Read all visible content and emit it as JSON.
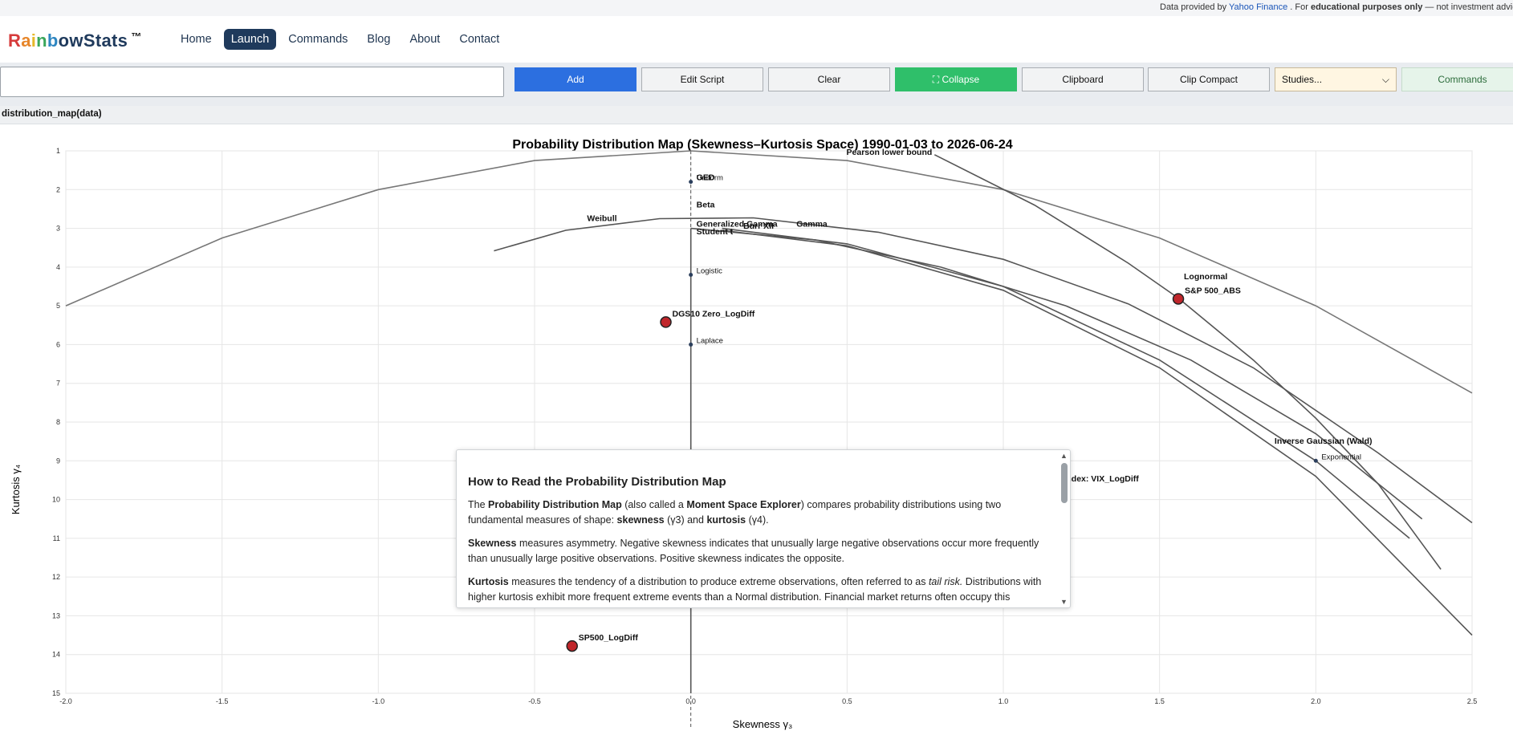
{
  "topinfo": {
    "prefix": "Data provided by",
    "source": "Yahoo Finance",
    "mid": ". For",
    "emph": "educational purposes only",
    "tail": "— not investment advice"
  },
  "brand": {
    "letters": [
      "R",
      "a",
      "i",
      "n",
      "b",
      "o",
      "w",
      "S",
      "t",
      "a",
      "t",
      "s"
    ],
    "colors": [
      "#d63b3b",
      "#e7862a",
      "#e5b82a",
      "#3aa65a",
      "#2e86c1",
      "#1f3a5c",
      "#1f3a5c",
      "#1f3a5c",
      "#1f3a5c",
      "#1f3a5c",
      "#1f3a5c",
      "#1f3a5c"
    ],
    "tm": "™"
  },
  "nav": {
    "home": "Home",
    "launch": "Launch",
    "commands": "Commands",
    "blog": "Blog",
    "about": "About",
    "contact": "Contact"
  },
  "toolbar": {
    "input_value": "",
    "add": "Add",
    "edit_script": "Edit Script",
    "clear": "Clear",
    "collapse": "⛶ Collapse",
    "clipboard": "Clipboard",
    "clip_compact": "Clip Compact",
    "studies": "Studies...",
    "commands": "Commands"
  },
  "expr": "distribution_map(data)",
  "help": {
    "title": "How to Read the Probability Distribution Map",
    "p1_a": "The",
    "p1_b": "Probability Distribution Map",
    "p1_c": "(also called a",
    "p1_d": "Moment Space Explorer",
    "p1_e": ") compares probability distributions using two fundamental measures of shape:",
    "p1_f": "skewness",
    "p1_g": "(γ3) and",
    "p1_h": "kurtosis",
    "p1_i": "(γ4).",
    "p2_a": "Skewness",
    "p2_b": "measures asymmetry. Negative skewness indicates that unusually large negative observations occur more frequently than unusually large positive observations. Positive skewness indicates the opposite.",
    "p3_a": "Kurtosis",
    "p3_b": "measures the tendency of a distribution to produce extreme observations, often referred to as",
    "p3_c": "tail risk.",
    "p3_d": "Distributions with higher kurtosis exhibit more frequent extreme events than a Normal distribution. Financial market returns often occupy this"
  },
  "chart_data": {
    "type": "scatter",
    "title": "Probability Distribution Map (Skewness–Kurtosis Space) 1990-01-03 to 2026-06-24",
    "xlabel": "Skewness γ₃",
    "ylabel": "Kurtosis γ₄",
    "xlim": [
      -2.0,
      2.5
    ],
    "ylim": [
      1,
      15
    ],
    "y_inverted": true,
    "xticks": [
      "-2.0",
      "-1.5",
      "-1.0",
      "-0.5",
      "0.0",
      "0.5",
      "1.0",
      "1.5",
      "2.0",
      "2.5"
    ],
    "xtick_values": [
      -2.0,
      -1.5,
      -1.0,
      -0.5,
      0.0,
      0.5,
      1.0,
      1.5,
      2.0,
      2.5
    ],
    "yticks": [
      "1",
      "2",
      "3",
      "4",
      "5",
      "6",
      "7",
      "8",
      "9",
      "10",
      "11",
      "12",
      "13",
      "14",
      "15"
    ],
    "ytick_values": [
      1,
      2,
      3,
      4,
      5,
      6,
      7,
      8,
      9,
      10,
      11,
      12,
      13,
      14,
      15
    ],
    "grid": true,
    "curves": [
      {
        "name": "Pearson lower bound",
        "color": "#777777",
        "points": [
          [
            -2.0,
            5.0
          ],
          [
            -1.5,
            3.25
          ],
          [
            -1.0,
            2.0
          ],
          [
            -0.5,
            1.25
          ],
          [
            0.0,
            1.0
          ],
          [
            0.5,
            1.25
          ],
          [
            1.0,
            2.0
          ],
          [
            1.5,
            3.25
          ],
          [
            2.0,
            5.0
          ],
          [
            2.5,
            7.25
          ]
        ]
      },
      {
        "name": "Lognormal",
        "color": "#555555",
        "points": [
          [
            0.78,
            1.1
          ],
          [
            1.1,
            2.4
          ],
          [
            1.4,
            3.9
          ],
          [
            1.56,
            4.8
          ],
          [
            1.8,
            6.4
          ],
          [
            2.0,
            7.9
          ],
          [
            2.2,
            9.6
          ],
          [
            2.4,
            11.8
          ]
        ]
      },
      {
        "name": "Weibull",
        "color": "#555555",
        "points": [
          [
            -0.63,
            3.58
          ],
          [
            -0.4,
            3.05
          ],
          [
            -0.1,
            2.75
          ],
          [
            0.2,
            2.73
          ],
          [
            0.6,
            3.1
          ],
          [
            1.0,
            3.8
          ],
          [
            1.4,
            4.95
          ],
          [
            1.8,
            6.6
          ],
          [
            2.2,
            8.8
          ],
          [
            2.5,
            10.6
          ]
        ]
      },
      {
        "name": "Generalized Gamma",
        "color": "#555555",
        "points": [
          [
            0.0,
            3.0
          ],
          [
            0.4,
            3.3
          ],
          [
            0.8,
            4.0
          ],
          [
            1.2,
            5.0
          ],
          [
            1.6,
            6.4
          ],
          [
            2.0,
            8.3
          ],
          [
            2.34,
            10.5
          ]
        ]
      },
      {
        "name": "Gamma",
        "color": "#555555",
        "points": [
          [
            0.1,
            3.0
          ],
          [
            0.5,
            3.4
          ],
          [
            1.0,
            4.5
          ],
          [
            1.5,
            6.4
          ],
          [
            2.0,
            9.0
          ],
          [
            2.3,
            11.0
          ]
        ]
      },
      {
        "name": "Burr XII",
        "color": "#555555",
        "points": [
          [
            0.1,
            3.05
          ],
          [
            0.5,
            3.45
          ],
          [
            1.0,
            4.6
          ],
          [
            1.5,
            6.6
          ],
          [
            2.0,
            9.4
          ],
          [
            2.5,
            13.5
          ]
        ]
      },
      {
        "name": "Student t",
        "color": "#555555",
        "points": [
          [
            0.0,
            3.0
          ],
          [
            0.0,
            15.0
          ]
        ]
      }
    ],
    "reference_points": [
      {
        "label": "Uniform",
        "x": 0.0,
        "y": 1.8
      },
      {
        "label": "GED",
        "x": 0.0,
        "y": 1.8,
        "bold": true
      },
      {
        "label": "Beta",
        "x": 0.0,
        "y": 2.5,
        "bold": true
      },
      {
        "label": "Generalized Gamma",
        "x": 0.0,
        "y": 3.0,
        "bold": true
      },
      {
        "label": "Burr XII",
        "x": 0.15,
        "y": 3.05,
        "bold": true
      },
      {
        "label": "Gamma",
        "x": 0.32,
        "y": 3.0,
        "bold": true
      },
      {
        "label": "Student t",
        "x": 0.0,
        "y": 3.2,
        "bold": true
      },
      {
        "label": "Weibull",
        "x": -0.35,
        "y": 2.85,
        "bold": true
      },
      {
        "label": "Logistic",
        "x": 0.0,
        "y": 4.2
      },
      {
        "label": "Laplace",
        "x": 0.0,
        "y": 6.0
      },
      {
        "label": "Exponential",
        "x": 2.0,
        "y": 9.0
      },
      {
        "label": "Inverse Gaussian (Wald)",
        "x": 1.85,
        "y": 8.6,
        "bold": true
      },
      {
        "label": "Lognormal",
        "x": 1.56,
        "y": 4.35,
        "bold": true
      },
      {
        "label": "Pearson lower bound",
        "x": 0.48,
        "y": 1.15,
        "bold": true
      }
    ],
    "series": [
      {
        "label": "S&P 500_ABS",
        "x": 1.56,
        "y": 4.82
      },
      {
        "label": "DGS10 Zero_LogDiff",
        "x": -0.08,
        "y": 5.42
      },
      {
        "label": "CBOE Volatility Index: VIX_LogDiff",
        "x": 0.97,
        "y": 9.68
      },
      {
        "label": "SP500_LogDiff",
        "x": -0.38,
        "y": 13.78
      }
    ],
    "series_color": "#c0262b"
  }
}
